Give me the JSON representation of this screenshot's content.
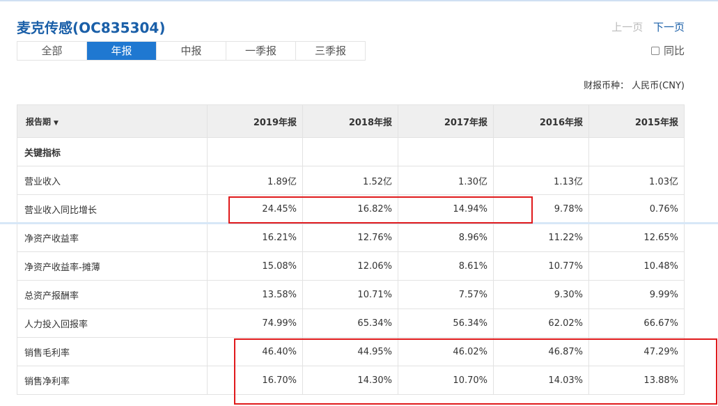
{
  "header": {
    "title": "麦克传感(OC835304)",
    "prev_label": "上一页",
    "next_label": "下一页"
  },
  "tabs": [
    {
      "label": "全部",
      "active": false
    },
    {
      "label": "年报",
      "active": true
    },
    {
      "label": "中报",
      "active": false
    },
    {
      "label": "一季报",
      "active": false
    },
    {
      "label": "三季报",
      "active": false
    }
  ],
  "compare_label": "同比",
  "currency_label": "财报币种： 人民币(CNY)",
  "table": {
    "header_label": "报告期",
    "caret": "▼",
    "columns": [
      "2019年报",
      "2018年报",
      "2017年报",
      "2016年报",
      "2015年报"
    ],
    "rows": [
      {
        "label": "关键指标",
        "values": [
          "",
          "",
          "",
          "",
          ""
        ]
      },
      {
        "label": "营业收入",
        "values": [
          "1.89亿",
          "1.52亿",
          "1.30亿",
          "1.13亿",
          "1.03亿"
        ]
      },
      {
        "label": "营业收入同比增长",
        "values": [
          "24.45%",
          "16.82%",
          "14.94%",
          "9.78%",
          "0.76%"
        ]
      },
      {
        "label": "净资产收益率",
        "values": [
          "16.21%",
          "12.76%",
          "8.96%",
          "11.22%",
          "12.65%"
        ]
      },
      {
        "label": "净资产收益率-摊薄",
        "values": [
          "15.08%",
          "12.06%",
          "8.61%",
          "10.77%",
          "10.48%"
        ]
      },
      {
        "label": "总资产报酬率",
        "values": [
          "13.58%",
          "10.71%",
          "7.57%",
          "9.30%",
          "9.99%"
        ]
      },
      {
        "label": "人力投入回报率",
        "values": [
          "74.99%",
          "65.34%",
          "56.34%",
          "62.02%",
          "66.67%"
        ]
      },
      {
        "label": "销售毛利率",
        "values": [
          "46.40%",
          "44.95%",
          "46.02%",
          "46.87%",
          "47.29%"
        ]
      },
      {
        "label": "销售净利率",
        "values": [
          "16.70%",
          "14.30%",
          "10.70%",
          "14.03%",
          "13.88%"
        ]
      }
    ]
  },
  "colors": {
    "accent": "#1f78d1",
    "title": "#1a5fa8",
    "highlight": "#e0191b"
  }
}
